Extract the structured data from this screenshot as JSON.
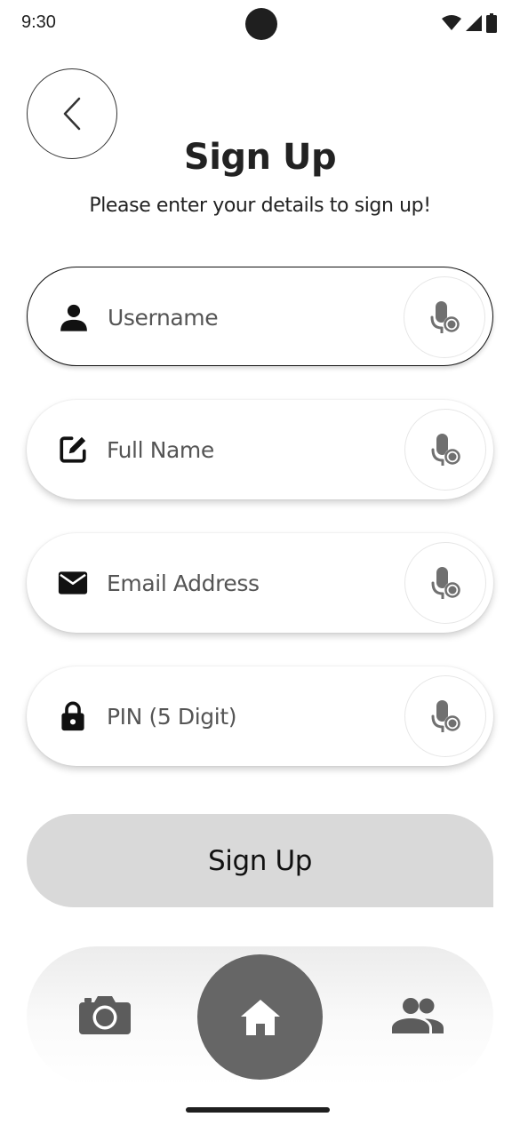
{
  "status_bar": {
    "time": "9:30"
  },
  "header": {
    "title": "Sign Up",
    "subtitle": "Please enter your details to sign up!"
  },
  "fields": [
    {
      "placeholder": "Username",
      "icon": "person-icon"
    },
    {
      "placeholder": "Full Name",
      "icon": "edit-icon"
    },
    {
      "placeholder": "Email Address",
      "icon": "mail-icon"
    },
    {
      "placeholder": "PIN (5 Digit)",
      "icon": "lock-icon"
    }
  ],
  "signup_button": {
    "label": "Sign Up"
  },
  "bottom_nav": {
    "items": [
      {
        "icon": "camera-icon"
      },
      {
        "icon": "home-icon",
        "active": true
      },
      {
        "icon": "people-icon"
      }
    ]
  },
  "colors": {
    "accent": "#666666",
    "button_bg": "#d9d9d9",
    "text": "#222222"
  }
}
